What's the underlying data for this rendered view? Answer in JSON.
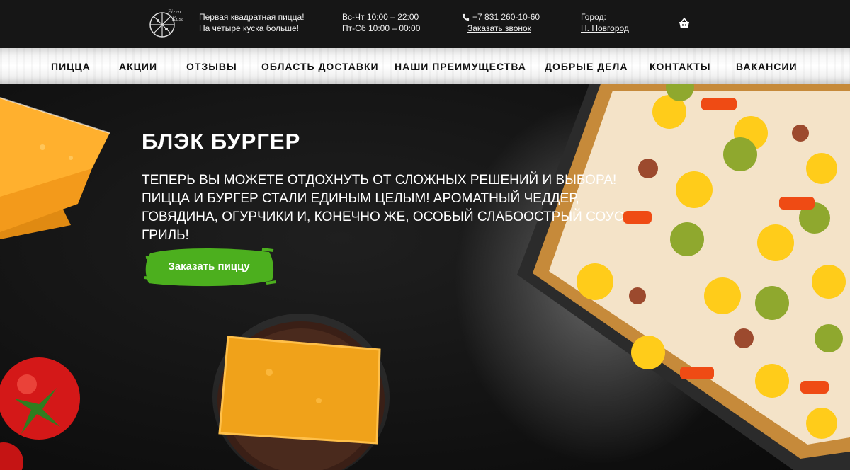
{
  "header": {
    "logo_icon": "pizza-slices-logo",
    "tagline_line1": "Первая квадратная пицца!",
    "tagline_line2": "На четыре куска больше!",
    "hours_line1": "Вс-Чт 10:00 – 22:00",
    "hours_line2": "Пт-Сб 10:00 – 00:00",
    "phone_icon": "phone-icon",
    "phone": "+7 831 260-10-60",
    "callback_link": "Заказать звонок",
    "city_label": "Город:",
    "city_value": "Н. Новгород",
    "cart_icon": "basket-icon"
  },
  "nav": {
    "items": [
      {
        "label": "Пицца"
      },
      {
        "label": "Акции"
      },
      {
        "label": "Отзывы"
      },
      {
        "label": "Область доставки"
      },
      {
        "label": "Наши преимущества"
      },
      {
        "label": "Добрые дела"
      },
      {
        "label": "Контакты"
      },
      {
        "label": "Вакансии"
      }
    ]
  },
  "hero": {
    "title": "БЛЭК БУРГЕР",
    "description": "ТЕПЕРЬ ВЫ МОЖЕТЕ ОТДОХНУТЬ ОТ СЛОЖНЫХ РЕШЕНИЙ И ВЫБОРА! ПИЦЦА И БУРГЕР СТАЛИ ЕДИНЫМ ЦЕЛЫМ! АРОМАТНЫЙ ЧЕДДЕР, ГОВЯДИНА, ОГУРЧИКИ И, КОНЕЧНО ЖЕ, ОСОБЫЙ СЛАБООСТРЫЙ СОУС ГРИЛЬ!",
    "order_button": "Заказать пиццу",
    "button_color": "#4caf1e"
  },
  "colors": {
    "header_bg": "#161616",
    "nav_bg": "#f4f4f4",
    "hero_bg": "#121212",
    "cheddar": "#f5a623"
  }
}
